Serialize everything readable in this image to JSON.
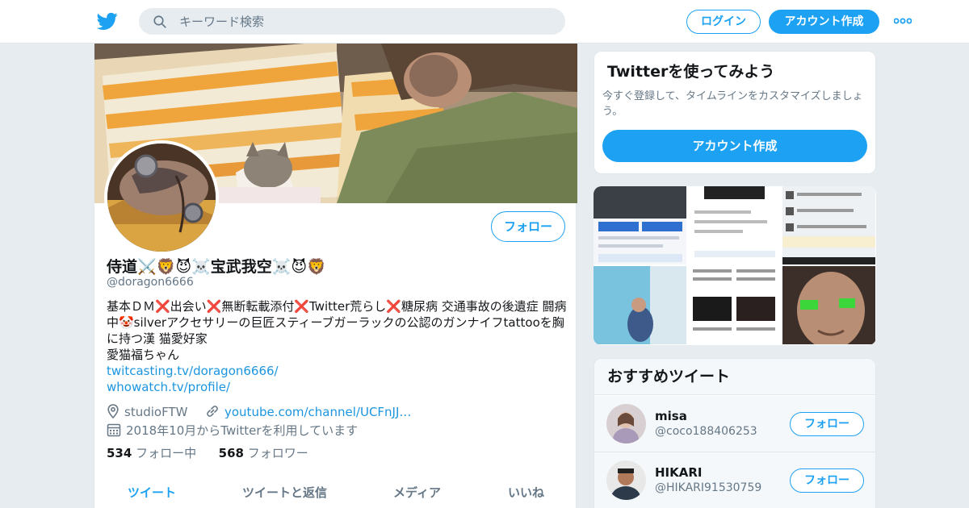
{
  "header": {
    "logo_icon": "twitter-bird-icon",
    "search_placeholder": "キーワード検索",
    "login_label": "ログイン",
    "signup_label": "アカウント作成",
    "more_icon": "more-dots-icon"
  },
  "profile": {
    "follow_label": "フォロー",
    "name": "侍道⚔️🦁😈☠️宝武我空☠️😈🦁",
    "handle": "@doragon6666",
    "bio_lines": [
      "基本ＤＭ❌出会い❌無断転載添付❌Twitter荒らし❌糖尿病 交通事故の後遺症 闘病",
      "中🤡silverアクセサリーの巨匠スティーブガーラックの公認のガンナイフtattooを胸",
      "に持つ漢 猫愛好家",
      "愛猫福ちゃん"
    ],
    "bio_links": [
      "twitcasting.tv/doragon6666/",
      "whowatch.tv/profile/"
    ],
    "location": "studioFTW",
    "website": "youtube.com/channel/UCFnJJ…",
    "joined": "2018年10月からTwitterを利用しています",
    "following_count": "534",
    "following_label": "フォロー中",
    "followers_count": "568",
    "followers_label": "フォロワー",
    "tabs": [
      "ツイート",
      "ツイートと返信",
      "メディア",
      "いいね"
    ]
  },
  "sidebar": {
    "signup_card": {
      "title": "Twitterを使ってみよう",
      "description": "今すぐ登録して、タイムラインをカスタマイズしましょう。",
      "button": "アカウント作成"
    },
    "recommend": {
      "title": "おすすめツイート",
      "users": [
        {
          "name": "misa",
          "handle": "@coco188406253",
          "button": "フォロー"
        },
        {
          "name": "HIKARI",
          "handle": "@HIKARI91530759",
          "button": "フォロー"
        }
      ]
    }
  },
  "colors": {
    "accent": "#1da1f2",
    "link": "#1b95e0",
    "muted": "#657786",
    "background": "#e6ecf0"
  }
}
